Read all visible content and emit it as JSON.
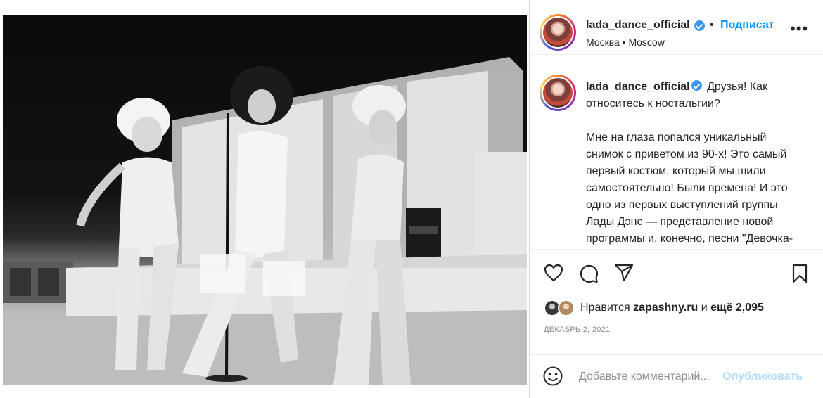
{
  "post": {
    "author": {
      "username": "lada_dance_official",
      "verified": true,
      "location": "Москва • Moscow"
    },
    "header": {
      "separator": "•",
      "follow_label": "Подписат",
      "more_label": "•••"
    },
    "caption": {
      "username": "lada_dance_official",
      "paragraphs": [
        "Друзья! Как относитесь к ностальгии?",
        "Мне на глаза попался уникальный снимок с приветом из 90-х! Это самый первый костюм, который мы шили самостоятельно! Были времена! И это одно из первых выступлений группы Лады Дэнс — представление новой программы и, конечно, песни \"Девочка-ночь\"."
      ]
    },
    "actions": {
      "like_icon": "heart-icon",
      "comment_icon": "comment-icon",
      "share_icon": "share-icon",
      "save_icon": "bookmark-icon"
    },
    "likes": {
      "prefix": "Нравится",
      "user": "zapashny.ru",
      "connector": "и",
      "others": "ещё 2,095"
    },
    "date": "ДЕКАБРЬ 2, 2021",
    "comment": {
      "placeholder": "Добавьте комментарий...",
      "publish_label": "Опубликовать",
      "emoji_icon": "emoji-smile-icon"
    },
    "colors": {
      "link_blue": "#0095f6",
      "publish_disabled": "#b2dffc",
      "verified_blue": "#3897f0",
      "muted_text": "#8e8e8e"
    }
  }
}
